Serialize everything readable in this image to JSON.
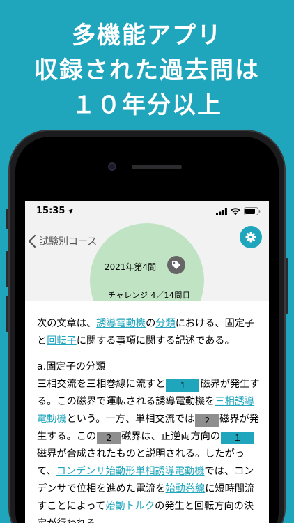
{
  "headline": {
    "line1": "多機能アプリ",
    "line2": "収録された過去問は",
    "line3": "１０年分以上"
  },
  "status_bar": {
    "time": "15:35"
  },
  "nav": {
    "back_label": "試験別コース",
    "exam_year": "2021年第4問",
    "progress": "チャレンジ 4／14問目"
  },
  "question": {
    "intro": {
      "t1": "次の文章は、",
      "link1": "誘導電動機",
      "t2": "の",
      "link2": "分類",
      "t3": "における、固定子と",
      "link3": "回転子",
      "t4": "に関する事項に関する記述である。"
    },
    "section_title": "a.固定子の分類",
    "body": {
      "s1": "三相交流を三相巻線に流すと",
      "blank1": "１",
      "s2": "磁界が発生する。この磁界で運転される誘導電動機を",
      "link_a": "三相誘導電動機",
      "s3": "という。一方、単相交流では",
      "blank2": "２",
      "s4": "磁界が発生する。この",
      "blank3": "２",
      "s5": "磁界は、正逆両方向の",
      "blank4": "１",
      "s6": "磁界が合成されたものと説明される。したがって、",
      "link_b": "コンデンサ始動形単相誘導電動機",
      "s7": "では、コンデンサで位相を進めた電流を",
      "link_c": "始動巻線",
      "s8": "に短時間流すことによって",
      "link_d": "始動トルク",
      "s9": "の発生と回転方向の決定が行われる。"
    }
  },
  "colors": {
    "background": "#1fa6bd",
    "accent": "#1fa6bd",
    "circle": "#bfe3c3",
    "blank_gray": "#8e8e8e"
  }
}
